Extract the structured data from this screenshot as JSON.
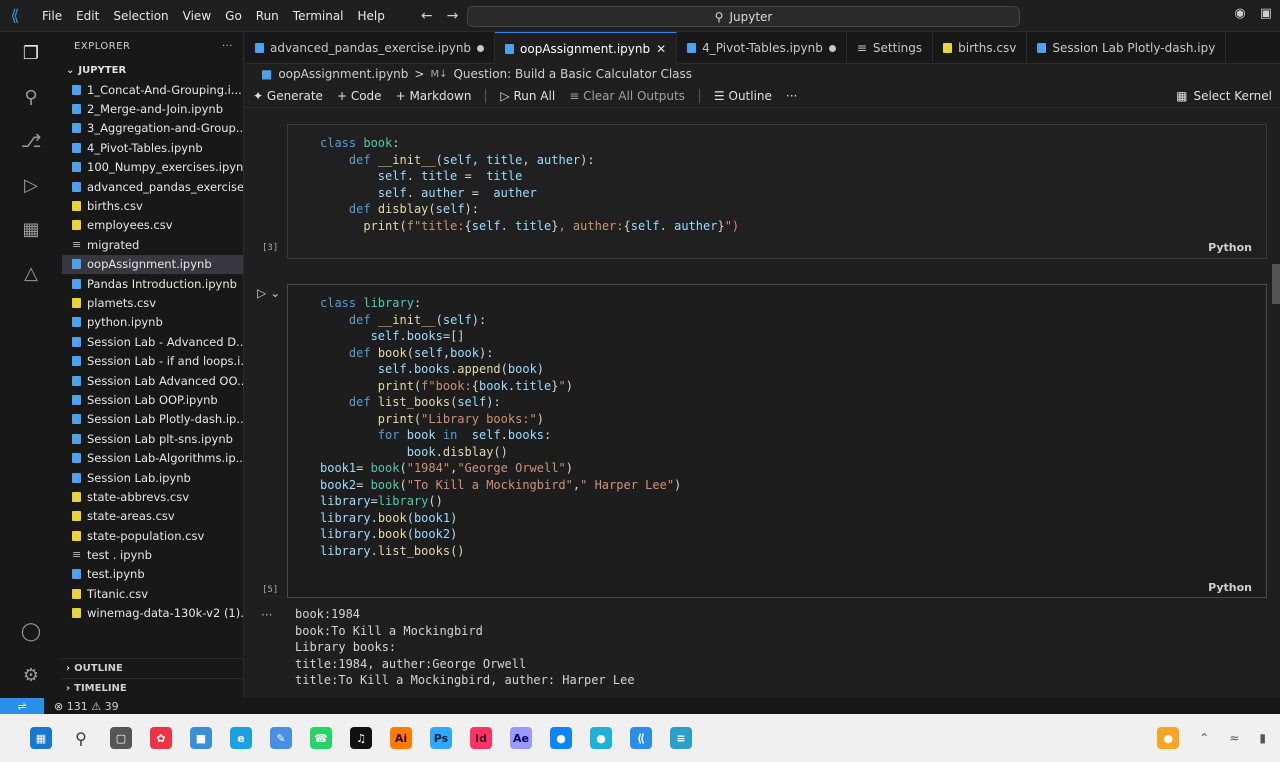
{
  "menu": [
    "File",
    "Edit",
    "Selection",
    "View",
    "Go",
    "Run",
    "Terminal",
    "Help"
  ],
  "search": {
    "text": "Jupyter"
  },
  "explorer": {
    "title": "EXPLORER",
    "folder": "JUPYTER",
    "files": [
      {
        "name": "1_Concat-And-Grouping.i...",
        "type": "nb"
      },
      {
        "name": "2_Merge-and-Join.ipynb",
        "type": "nb"
      },
      {
        "name": "3_Aggregation-and-Group...",
        "type": "nb"
      },
      {
        "name": "4_Pivot-Tables.ipynb",
        "type": "nb"
      },
      {
        "name": "100_Numpy_exercises.ipynb",
        "type": "nb"
      },
      {
        "name": "advanced_pandas_exercise...",
        "type": "nb"
      },
      {
        "name": "births.csv",
        "type": "csv"
      },
      {
        "name": "employees.csv",
        "type": "csv"
      },
      {
        "name": "migrated",
        "type": "plain"
      },
      {
        "name": "oopAssignment.ipynb",
        "type": "nb",
        "selected": true
      },
      {
        "name": "Pandas Introduction.ipynb",
        "type": "nb"
      },
      {
        "name": "plamets.csv",
        "type": "csv"
      },
      {
        "name": "python.ipynb",
        "type": "nb"
      },
      {
        "name": "Session Lab - Advanced D...",
        "type": "nb"
      },
      {
        "name": "Session Lab - if and loops.i...",
        "type": "nb"
      },
      {
        "name": "Session Lab Advanced OO...",
        "type": "nb"
      },
      {
        "name": "Session Lab OOP.ipynb",
        "type": "nb"
      },
      {
        "name": "Session Lab Plotly-dash.ip...",
        "type": "nb"
      },
      {
        "name": "Session Lab plt-sns.ipynb",
        "type": "nb"
      },
      {
        "name": "Session Lab-Algorithms.ip...",
        "type": "nb"
      },
      {
        "name": "Session Lab.ipynb",
        "type": "nb"
      },
      {
        "name": "state-abbrevs.csv",
        "type": "csv"
      },
      {
        "name": "state-areas.csv",
        "type": "csv"
      },
      {
        "name": "state-population.csv",
        "type": "csv"
      },
      {
        "name": "test . ipynb",
        "type": "plain"
      },
      {
        "name": "test.ipynb",
        "type": "nb"
      },
      {
        "name": "Titanic.csv",
        "type": "csv"
      },
      {
        "name": "winemag-data-130k-v2 (1)...",
        "type": "csv"
      }
    ],
    "outline": "OUTLINE",
    "timeline": "TIMELINE"
  },
  "tabs": [
    {
      "label": "advanced_pandas_exercise.ipynb",
      "state": "dot"
    },
    {
      "label": "oopAssignment.ipynb",
      "state": "close",
      "active": true
    },
    {
      "label": "4_Pivot-Tables.ipynb",
      "state": "dot"
    },
    {
      "label": "Settings",
      "state": ""
    },
    {
      "label": "births.csv",
      "state": ""
    },
    {
      "label": "Session Lab Plotly-dash.ipy",
      "state": ""
    }
  ],
  "breadcrumb": {
    "file": "oopAssignment.ipynb",
    "sep": ">",
    "md": "M↓",
    "section": "Question: Build a Basic Calculator Class"
  },
  "toolbar": {
    "generate": "Generate",
    "code": "Code",
    "markdown": "Markdown",
    "run_all": "Run All",
    "clear": "Clear All Outputs",
    "outline": "Outline",
    "more": "···",
    "kernel": "Select Kernel"
  },
  "cells": [
    {
      "exec": "[3]",
      "lang": "Python"
    },
    {
      "exec": "[5]",
      "lang": "Python"
    }
  ],
  "output": "book:1984\nbook:To Kill a Mockingbird\nLibrary books:\ntitle:1984, auther:George Orwell\ntitle:To Kill a Mockingbird, auther: Harper Lee",
  "status": {
    "errors": "131",
    "warnings": "39"
  },
  "colors": {
    "accent": "#2c8ee8",
    "keyword": "#569cd6",
    "function": "#dcdcaa",
    "string": "#ce9178"
  }
}
